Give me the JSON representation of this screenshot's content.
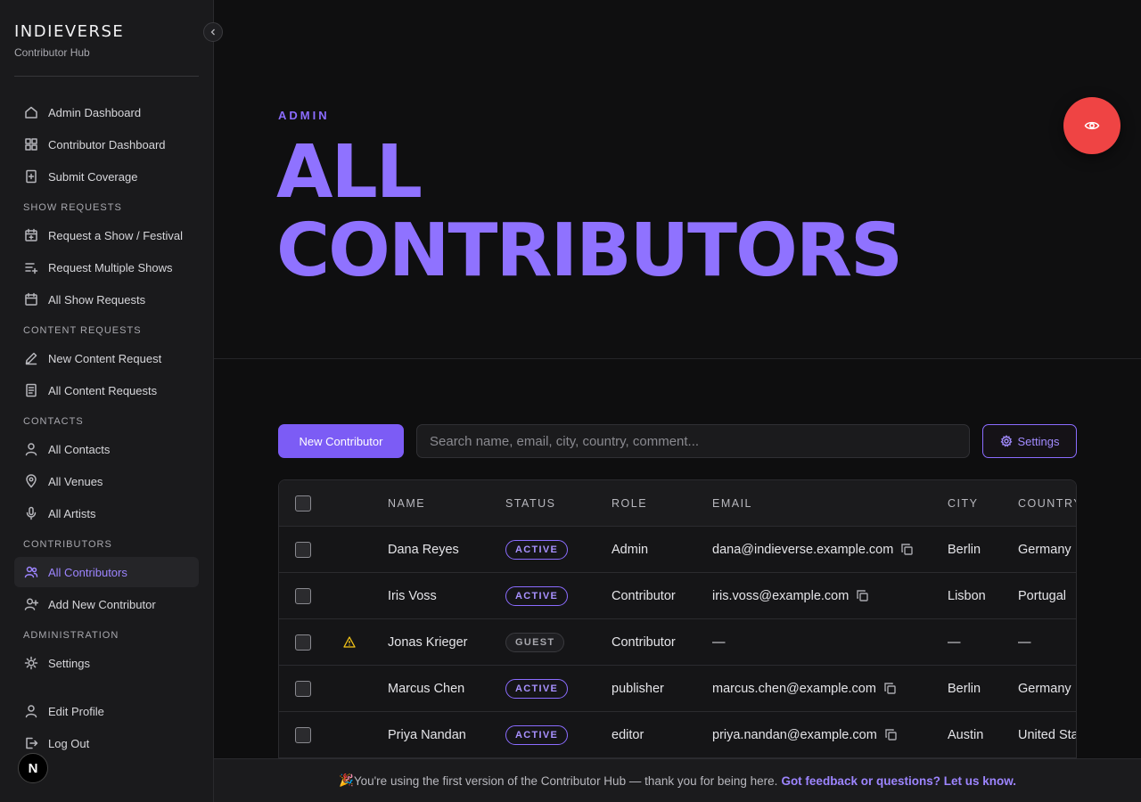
{
  "brand": {
    "title": "INDIEVERSE",
    "subtitle": "Contributor Hub"
  },
  "nav": {
    "top": [
      {
        "label": "Admin Dashboard",
        "icon": "home-icon"
      },
      {
        "label": "Contributor Dashboard",
        "icon": "grid-icon"
      },
      {
        "label": "Submit Coverage",
        "icon": "file-plus-icon"
      }
    ],
    "show_requests": {
      "title": "SHOW REQUESTS",
      "items": [
        {
          "label": "Request a Show / Festival",
          "icon": "calendar-plus-icon"
        },
        {
          "label": "Request Multiple Shows",
          "icon": "list-plus-icon"
        },
        {
          "label": "All Show Requests",
          "icon": "calendar-icon"
        }
      ]
    },
    "content_requests": {
      "title": "CONTENT REQUESTS",
      "items": [
        {
          "label": "New Content Request",
          "icon": "pen-icon"
        },
        {
          "label": "All Content Requests",
          "icon": "document-icon"
        }
      ]
    },
    "contacts": {
      "title": "CONTACTS",
      "items": [
        {
          "label": "All Contacts",
          "icon": "user-icon"
        },
        {
          "label": "All Venues",
          "icon": "map-pin-icon"
        },
        {
          "label": "All Artists",
          "icon": "microphone-icon"
        }
      ]
    },
    "contributors": {
      "title": "CONTRIBUTORS",
      "items": [
        {
          "label": "All Contributors",
          "icon": "users-icon",
          "active": true
        },
        {
          "label": "Add New Contributor",
          "icon": "user-plus-icon"
        }
      ]
    },
    "administration": {
      "title": "ADMINISTRATION",
      "items": [
        {
          "label": "Settings",
          "icon": "sun-gear-icon"
        }
      ]
    },
    "bottom": [
      {
        "label": "Edit Profile",
        "icon": "user-icon"
      },
      {
        "label": "Log Out",
        "icon": "logout-icon"
      }
    ]
  },
  "dev_badge": "N",
  "hero": {
    "eyebrow": "ADMIN",
    "title_line1": "ALL",
    "title_line2": "CONTRIBUTORS"
  },
  "toolbar": {
    "new_label": "New Contributor",
    "search_placeholder": "Search name, email, city, country, comment...",
    "search_value": "",
    "settings_label": "Settings"
  },
  "table": {
    "columns": [
      "NAME",
      "STATUS",
      "ROLE",
      "EMAIL",
      "CITY",
      "COUNTRY"
    ],
    "rows": [
      {
        "warning": false,
        "name": "Dana Reyes",
        "status": "ACTIVE",
        "role": "Admin",
        "email": "dana@indieverse.example.com",
        "city": "Berlin",
        "country": "Germany"
      },
      {
        "warning": false,
        "name": "Iris Voss",
        "status": "ACTIVE",
        "role": "Contributor",
        "email": "iris.voss@example.com",
        "city": "Lisbon",
        "country": "Portugal"
      },
      {
        "warning": true,
        "name": "Jonas Krieger",
        "status": "GUEST",
        "role": "Contributor",
        "email": "—",
        "city": "—",
        "country": "—"
      },
      {
        "warning": false,
        "name": "Marcus Chen",
        "status": "ACTIVE",
        "role": "publisher",
        "email": "marcus.chen@example.com",
        "city": "Berlin",
        "country": "Germany"
      },
      {
        "warning": false,
        "name": "Priya Nandan",
        "status": "ACTIVE",
        "role": "editor",
        "email": "priya.nandan@example.com",
        "city": "Austin",
        "country": "United States"
      }
    ]
  },
  "footer": {
    "emoji": "🎉",
    "message": "You're using the first version of the Contributor Hub — thank you for being here.",
    "link": "Got feedback or questions? Let us know."
  },
  "colors": {
    "accent": "#8b6cff",
    "fab": "#ef4444",
    "warning": "#f5c518"
  }
}
